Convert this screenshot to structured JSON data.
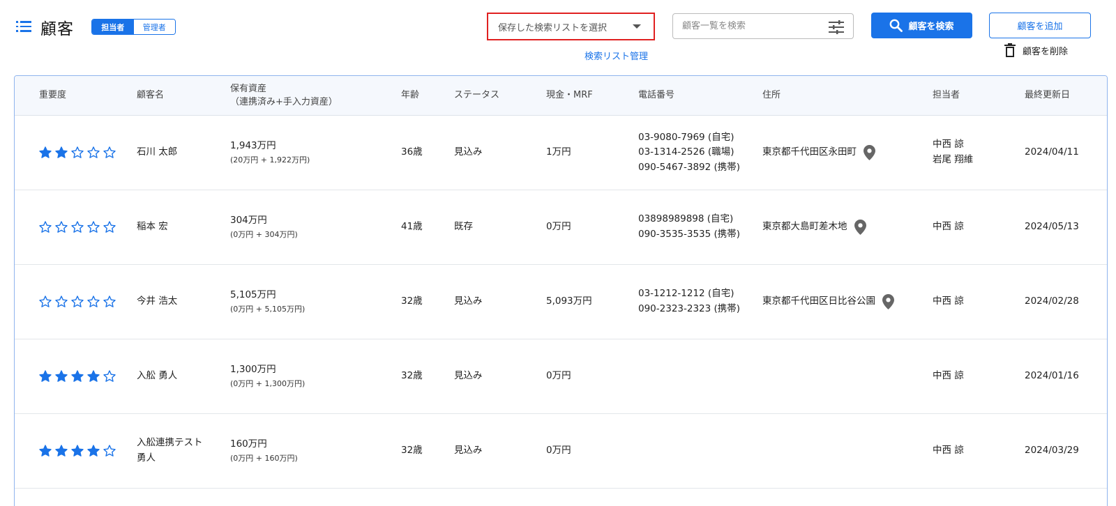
{
  "header": {
    "title": "顧客",
    "roles": [
      "担当者",
      "管理者"
    ],
    "active_role": "担当者",
    "saved_list_placeholder": "保存した検索リストを選択",
    "list_manage_link": "検索リスト管理",
    "search_placeholder": "顧客一覧を検索",
    "search_button": "顧客を検索",
    "add_button": "顧客を追加",
    "delete_button": "顧客を削除"
  },
  "colors": {
    "accent": "#1a73e8",
    "highlight_border": "#e02020",
    "pin": "#666666"
  },
  "table": {
    "columns": {
      "importance": "重要度",
      "name": "顧客名",
      "assets_line1": "保有資産",
      "assets_line2": "（連携済み+手入力資産）",
      "age": "年齢",
      "status": "ステータス",
      "cash": "現金・MRF",
      "phone": "電話番号",
      "address": "住所",
      "staff": "担当者",
      "updated": "最終更新日"
    },
    "rows": [
      {
        "stars": 2,
        "name_line1": "石川 太郎",
        "name_line2": "",
        "assets": "1,943万円",
        "assets_detail": "(20万円 + 1,922万円)",
        "age": "36歳",
        "status": "見込み",
        "cash": "1万円",
        "phones": [
          "03-9080-7969 (自宅)",
          "03-1314-2526 (職場)",
          "090-5467-3892 (携帯)"
        ],
        "address": "東京都千代田区永田町",
        "staff": [
          "中西 諒",
          "岩尾 翔維"
        ],
        "updated": "2024/04/11"
      },
      {
        "stars": 0,
        "name_line1": "稲本 宏",
        "name_line2": "",
        "assets": "304万円",
        "assets_detail": "(0万円 + 304万円)",
        "age": "41歳",
        "status": "既存",
        "cash": "0万円",
        "phones": [
          "03898989898 (自宅)",
          "090-3535-3535 (携帯)",
          ""
        ],
        "address": "東京都大島町差木地",
        "staff": [
          "中西 諒",
          ""
        ],
        "updated": "2024/05/13"
      },
      {
        "stars": 0,
        "name_line1": "今井 浩太",
        "name_line2": "",
        "assets": "5,105万円",
        "assets_detail": "(0万円 + 5,105万円)",
        "age": "32歳",
        "status": "見込み",
        "cash": "5,093万円",
        "phones": [
          "03-1212-1212 (自宅)",
          "090-2323-2323 (携帯)",
          ""
        ],
        "address": "東京都千代田区日比谷公園",
        "staff": [
          "中西 諒",
          ""
        ],
        "updated": "2024/02/28"
      },
      {
        "stars": 4,
        "name_line1": "入舩 勇人",
        "name_line2": "",
        "assets": "1,300万円",
        "assets_detail": "(0万円 + 1,300万円)",
        "age": "32歳",
        "status": "見込み",
        "cash": "0万円",
        "phones": [
          "",
          "",
          ""
        ],
        "address": "",
        "staff": [
          "中西 諒",
          ""
        ],
        "updated": "2024/01/16"
      },
      {
        "stars": 4,
        "name_line1": "入舩連携テスト",
        "name_line2": "勇人",
        "assets": "160万円",
        "assets_detail": "(0万円 + 160万円)",
        "age": "32歳",
        "status": "見込み",
        "cash": "0万円",
        "phones": [
          "",
          "",
          ""
        ],
        "address": "",
        "staff": [
          "中西 諒",
          ""
        ],
        "updated": "2024/03/29"
      }
    ]
  }
}
